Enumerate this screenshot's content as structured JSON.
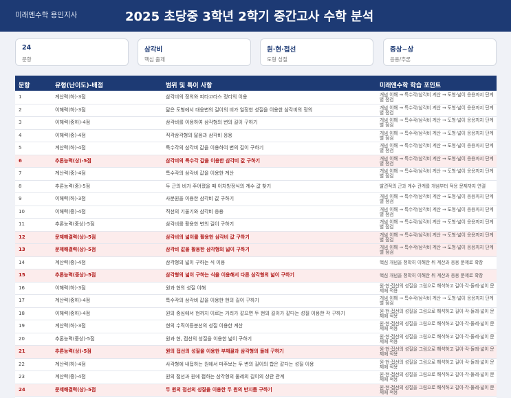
{
  "header": {
    "brand": "미래엔수학 용인지사",
    "title": "2025 초당중 3학년 2학기 중간고사 수학 분석"
  },
  "cards": [
    {
      "value": "24",
      "sub": "문항"
    },
    {
      "value": "삼각비",
      "sub": "핵심 출제"
    },
    {
      "value": "원·현·접선",
      "sub": "도형 성질"
    },
    {
      "value": "중상~상",
      "sub": "응용/추론"
    }
  ],
  "table": {
    "columns": [
      "문항",
      "유형(난이도)-배점",
      "범위 및 특이 사항",
      "미래엔수학 학습 포인트"
    ],
    "rows": [
      {
        "no": "1",
        "type": "계산력(하)-3점",
        "scope": "삼각비의 정의와 피타고라스 정리의 이용",
        "point": "개념 이해 → 특수각/삼각비 계산 → 도형·넓이 응용까지 단계별 점검",
        "hl": false
      },
      {
        "no": "2",
        "type": "이해력(하)-3점",
        "scope": "닮은 도형에서 대응변의 길이의 비가 일정한 성질을 이용한 삼각비의 정의",
        "point": "개념 이해 → 특수각/삼각비 계산 → 도형·넓이 응용까지 단계별 점검",
        "hl": false
      },
      {
        "no": "3",
        "type": "이해력(중하)-4점",
        "scope": "삼각비를 이용하여 삼각형의 변의 길이 구하기",
        "point": "개념 이해 → 특수각/삼각비 계산 → 도형·넓이 응용까지 단계별 점검",
        "hl": false
      },
      {
        "no": "4",
        "type": "이해력(중)-4점",
        "scope": "직각삼각형의 닮음과 삼각비 응용",
        "point": "개념 이해 → 특수각/삼각비 계산 → 도형·넓이 응용까지 단계별 점검",
        "hl": false
      },
      {
        "no": "5",
        "type": "계산력(하)-4점",
        "scope": "특수각의 삼각비 값을 이용하여 변의 길이 구하기",
        "point": "개념 이해 → 특수각/삼각비 계산 → 도형·넓이 응용까지 단계별 점검",
        "hl": false
      },
      {
        "no": "6",
        "type": "추론능력(상)-5점",
        "scope": "삼각비의 특수각 값을 이용한 삼각비 값 구하기",
        "point": "개념 이해 → 특수각/삼각비 계산 → 도형·넓이 응용까지 단계별 점검",
        "hl": true
      },
      {
        "no": "7",
        "type": "계산력(중)-4점",
        "scope": "특수각의 삼각비 값을 이용한 계산",
        "point": "개념 이해 → 특수각/삼각비 계산 → 도형·넓이 응용까지 단계별 점검",
        "hl": false
      },
      {
        "no": "8",
        "type": "추론능력(중)-5점",
        "scope": "두 근의 비가 주어졌을 때 이차방정식의 계수 값 찾기",
        "point": "발견적의 근과 계수 관계를 개념부터 적용 문제까지 연결",
        "hl": false
      },
      {
        "no": "9",
        "type": "이해력(하)-3점",
        "scope": "사분원을 이용한 삼각비 값 구하기",
        "point": "개념 이해 → 특수각/삼각비 계산 → 도형·넓이 응용까지 단계별 점검",
        "hl": false
      },
      {
        "no": "10",
        "type": "이해력(중)-4점",
        "scope": "직선의 기울기와 삼각비 응용",
        "point": "개념 이해 → 특수각/삼각비 계산 → 도형·넓이 응용까지 단계별 점검",
        "hl": false
      },
      {
        "no": "11",
        "type": "추론능력(중상)-5점",
        "scope": "삼각비를 활용한 변의 길이 구하기",
        "point": "개념 이해 → 특수각/삼각비 계산 → 도형·넓이 응용까지 단계별 점검",
        "hl": false
      },
      {
        "no": "12",
        "type": "문제해결력(상)-5점",
        "scope": "삼각비의 넓이를 활용한 삼각비 값 구하기",
        "point": "개념 이해 → 특수각/삼각비 계산 → 도형·넓이 응용까지 단계별 점검",
        "hl": true
      },
      {
        "no": "13",
        "type": "문제해결력(상)-5점",
        "scope": "삼각비 값을 활용한 삼각형의 넓이 구하기",
        "point": "개념 이해 → 특수각/삼각비 계산 → 도형·넓이 응용까지 단계별 점검",
        "hl": true
      },
      {
        "no": "14",
        "type": "계산력(중)-4점",
        "scope": "삼각형의 넓이 구하는 식 이용",
        "point": "핵심 개념을 정확히 이해한 뒤 계산과 응용 문제로 확장",
        "hl": false
      },
      {
        "no": "15",
        "type": "추론능력(중상)-5점",
        "scope": "삼각형의 넓이 구하는 식을 이용해서 다른 삼각형의 넓이 구하기",
        "point": "핵심 개념을 정확히 이해한 뒤 계산과 응용 문제로 확장",
        "hl": true
      },
      {
        "no": "16",
        "type": "이해력(하)-3점",
        "scope": "원과 현의 성질 이해",
        "point": "원·현·접선의 성질을 그림으로 해석하고 길이·각·둘레·넓이 문제에 적용",
        "hl": false
      },
      {
        "no": "17",
        "type": "계산력(중하)-4점",
        "scope": "특수각의 삼각비 값을 이용한 현의 길이 구하기",
        "point": "개념 이해 → 특수각/삼각비 계산 → 도형·넓이 응용까지 단계별 점검",
        "hl": false
      },
      {
        "no": "18",
        "type": "이해력(중하)-4점",
        "scope": "원의 중심에서 현까지 이르는 거리가 같으면 두 현의 길이가 같다는 성질 이용한 각 구하기",
        "point": "원·현·접선의 성질을 그림으로 해석하고 길이·각·둘레·넓이 문제에 적용",
        "hl": false
      },
      {
        "no": "19",
        "type": "계산력(하)-3점",
        "scope": "현의 수직이등분선의 성질 이용한 계산",
        "point": "원·현·접선의 성질을 그림으로 해석하고 길이·각·둘레·넓이 문제에 적용",
        "hl": false
      },
      {
        "no": "20",
        "type": "추론능력(중상)-5점",
        "scope": "원과 현, 접선의 성질을 이용한 넓이 구하기",
        "point": "원·현·접선의 성질을 그림으로 해석하고 길이·각·둘레·넓이 문제에 적용",
        "hl": false
      },
      {
        "no": "21",
        "type": "추론능력(상)-5점",
        "scope": "원의 접선의 성질을 이용한 부채꼴과 삼각형의 둘레 구하기",
        "point": "원·현·접선의 성질을 그림으로 해석하고 길이·각·둘레·넓이 문제에 적용",
        "hl": true
      },
      {
        "no": "22",
        "type": "계산력(하)-4점",
        "scope": "사각형에 내접하는 원에서 마주보는 두 변의 길이의 합은 같다는 성질 이용",
        "point": "원·현·접선의 성질을 그림으로 해석하고 길이·각·둘레·넓이 문제에 적용",
        "hl": false
      },
      {
        "no": "23",
        "type": "계산력(중)-4점",
        "scope": "원의 접선과 원에 접하는 삼각형의 둘레의 길이의 상관 관계",
        "point": "원·현·접선의 성질을 그림으로 해석하고 길이·각·둘레·넓이 문제에 적용",
        "hl": false
      },
      {
        "no": "24",
        "type": "문제해결력(상)-5점",
        "scope": "두 원의 접선의 성질을 이용한 두 원의 반지름 구하기",
        "point": "원·현·접선의 성질을 그림으로 해석하고 길이·각·둘레·넓이 문제에 적용",
        "hl": true
      }
    ]
  }
}
